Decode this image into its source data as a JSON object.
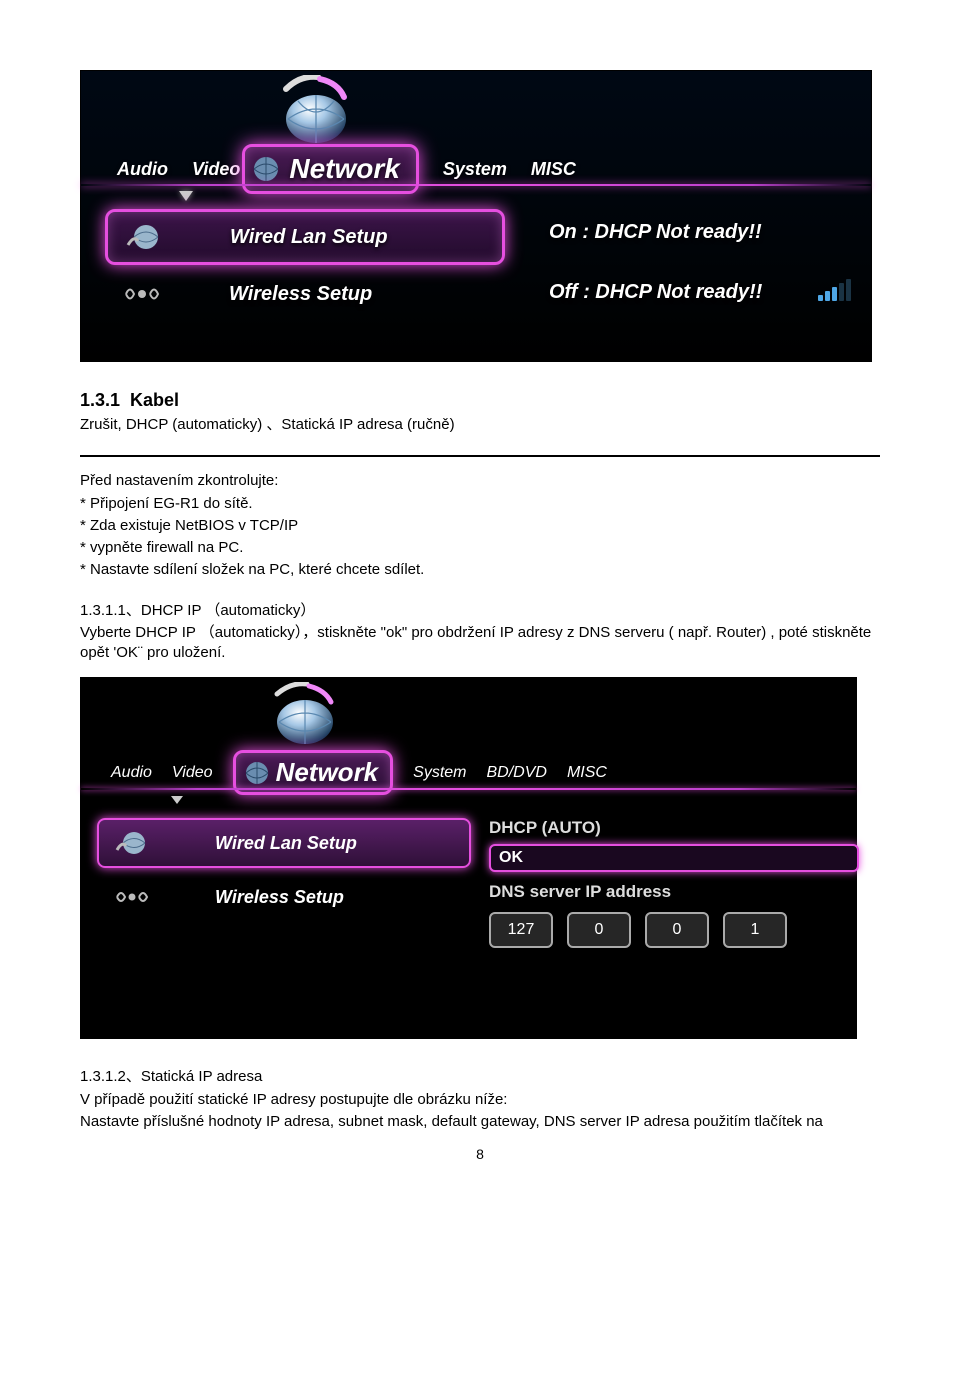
{
  "screenshot1": {
    "tabs": [
      "Audio",
      "Video",
      "Network",
      "System",
      "MISC"
    ],
    "active_tab": "Network",
    "menu": {
      "wired": "Wired Lan Setup",
      "wireless": "Wireless Setup"
    },
    "status_on": "On : DHCP Not ready!!",
    "status_off": "Off : DHCP Not ready!!"
  },
  "section1": {
    "num": "1.3.1",
    "title": "Kabel",
    "line1": "Zrušit, DHCP (automaticky) 、Statická IP adresa (ručně)"
  },
  "before_setup_heading": "Před nastavením zkontrolujte:",
  "check1": "* Připojení EG-R1 do sítě.",
  "check2": "* Zda existuje NetBIOS v TCP/IP",
  "check3": "* vypněte firewall na PC.",
  "check4": "* Nastavte sdílení složek na PC, které chcete sdílet.",
  "sub1": {
    "heading": "1.3.1.1、DHCP IP （automaticky）",
    "line1": "Vyberte DHCP IP （automaticky），stiskněte \"ok\" pro obdržení IP adresy z DNS serveru ( např. Router) , poté stiskněte opět 'OK¨ pro uložení."
  },
  "screenshot2": {
    "tabs": [
      "Audio",
      "Video",
      "Network",
      "System",
      "BD/DVD",
      "MISC"
    ],
    "active_tab": "Network",
    "menu": {
      "wired": "Wired Lan Setup",
      "wireless": "Wireless Setup"
    },
    "dhcp_label": "DHCP (AUTO)",
    "ok_label": "OK",
    "dns_label": "DNS server IP address",
    "ip": [
      "127",
      "0",
      "0",
      "1"
    ]
  },
  "sub2": {
    "heading": "1.3.1.2、Statická IP adresa",
    "line1": "V případě použití statické IP adresy postupujte dle obrázku níže:",
    "line2": "Nastavte příslušné hodnoty IP adresa, subnet mask, default gateway, DNS server IP adresa použitím tlačítek na"
  },
  "page_number": "8"
}
